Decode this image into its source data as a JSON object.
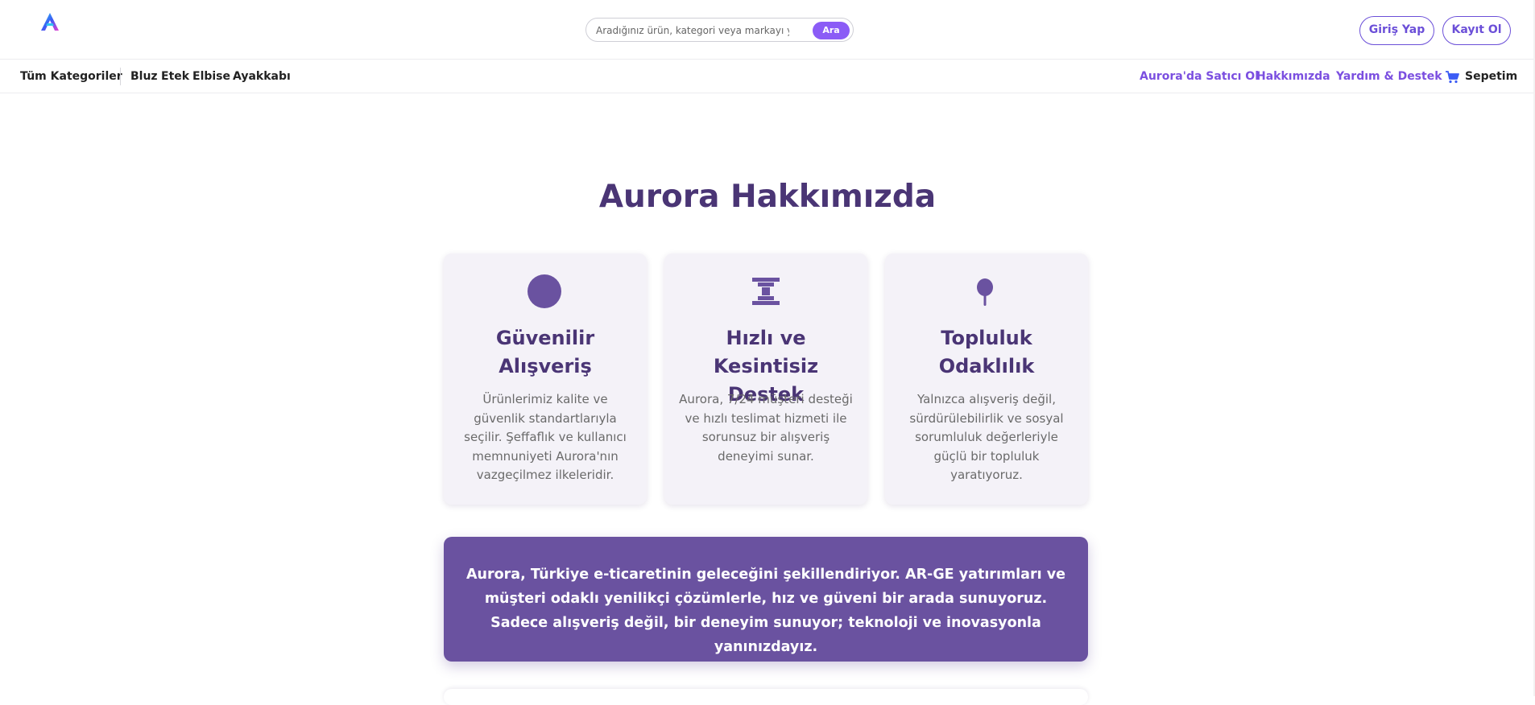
{
  "header": {
    "logo_icon": "aurora-a-logo-icon",
    "search": {
      "placeholder": "Aradığınız ürün, kategori veya markayı yazınız",
      "button_label": "Ara"
    },
    "login_label": "Giriş Yap",
    "register_label": "Kayıt Ol"
  },
  "nav": {
    "all_categories": "Tüm Kategoriler",
    "categories": [
      "Bluz",
      "Etek",
      "Elbise",
      "Ayakkabı"
    ],
    "right_links": [
      "Aurora'da Satıcı Ol",
      "Hakkımızda",
      "Yardım & Destek"
    ],
    "cart_icon": "cart-icon",
    "cart_label": "Sepetim"
  },
  "main": {
    "title": "Aurora Hakkımızda",
    "cards": [
      {
        "icon": "circle-icon",
        "title": "Güvenilir Alışveriş",
        "text": "Ürünlerimiz kalite ve güvenlik standartlarıyla seçilir. Şeffaflık ve kullanıcı memnuniyeti Aurora'nın vazgeçilmez ilkeleridir."
      },
      {
        "icon": "hourglass-icon",
        "title": "Hızlı ve Kesintisiz Destek",
        "text": "Aurora, 7/24 müşteri desteği ve hızlı teslimat hizmeti ile sorunsuz bir alışveriş deneyimi sunar."
      },
      {
        "icon": "tree-icon",
        "title": "Topluluk Odaklılık",
        "text": "Yalnızca alışveriş değil, sürdürülebilirlik ve sosyal sorumluluk değerleriyle güçlü bir topluluk yaratıyoruz."
      }
    ],
    "banner_text": "Aurora, Türkiye e-ticaretinin geleceğini şekillendiriyor. AR-GE yatırımları ve müşteri odaklı yenilikçi çözümlerle, hız ve güveni bir arada sunuyoruz. Sadece alışveriş değil, bir deneyim sunuyor; teknoloji ve inovasyonla yanınızdayız."
  },
  "colors": {
    "accent": "#8b5cf6",
    "brand_dark": "#4a3575",
    "banner_bg": "#6a52a0",
    "card_bg": "#f4f2f8"
  }
}
